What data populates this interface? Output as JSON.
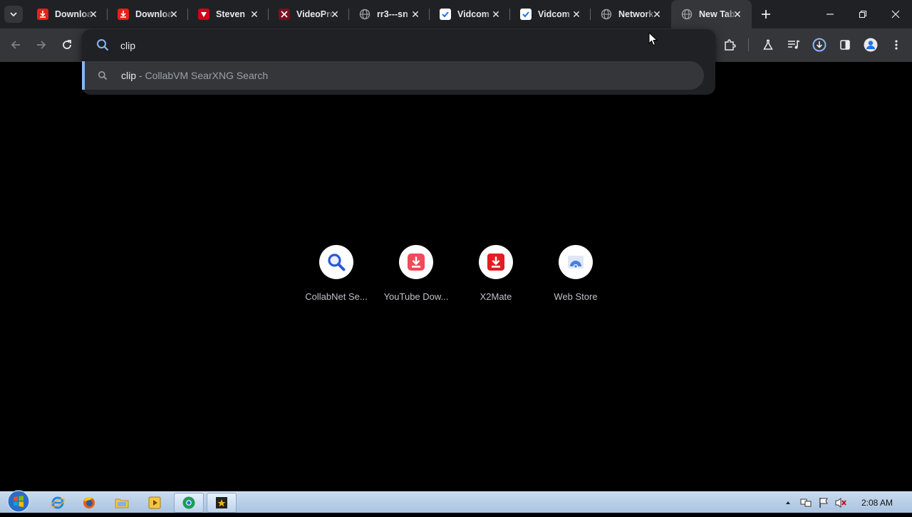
{
  "tabs": [
    {
      "title": "Download",
      "favicon": "download-red-icon",
      "active": false
    },
    {
      "title": "Download",
      "favicon": "download-red-icon",
      "active": false
    },
    {
      "title": "Steven",
      "favicon": "red-shield-icon",
      "active": false
    },
    {
      "title": "VideoProc",
      "favicon": "videoproc-icon",
      "active": false
    },
    {
      "title": "rr3---sn",
      "favicon": "globe-icon",
      "active": false
    },
    {
      "title": "Vidcom",
      "favicon": "shield-check-icon",
      "active": false
    },
    {
      "title": "Vidcom",
      "favicon": "shield-check-icon",
      "active": false
    },
    {
      "title": "Network",
      "favicon": "globe-icon",
      "active": false
    },
    {
      "title": "New Tab",
      "favicon": "globe-icon",
      "active": true
    }
  ],
  "omnibox": {
    "query": "clip",
    "suggestion": {
      "query": "clip",
      "separator": " - ",
      "engine": "CollabVM SearXNG Search"
    }
  },
  "shortcuts": [
    {
      "label": "CollabNet Se...",
      "icon": "magnifier-icon"
    },
    {
      "label": "YouTube Dow...",
      "icon": "download-red-icon"
    },
    {
      "label": "X2Mate",
      "icon": "download-red-icon"
    },
    {
      "label": "Web Store",
      "icon": "web-store-icon"
    }
  ],
  "taskbar": {
    "clock": "2:08 AM"
  },
  "colors": {
    "tabstrip": "#202124",
    "toolbar": "#35363a",
    "accent": "#8ab4f8",
    "page_bg": "#000000"
  }
}
